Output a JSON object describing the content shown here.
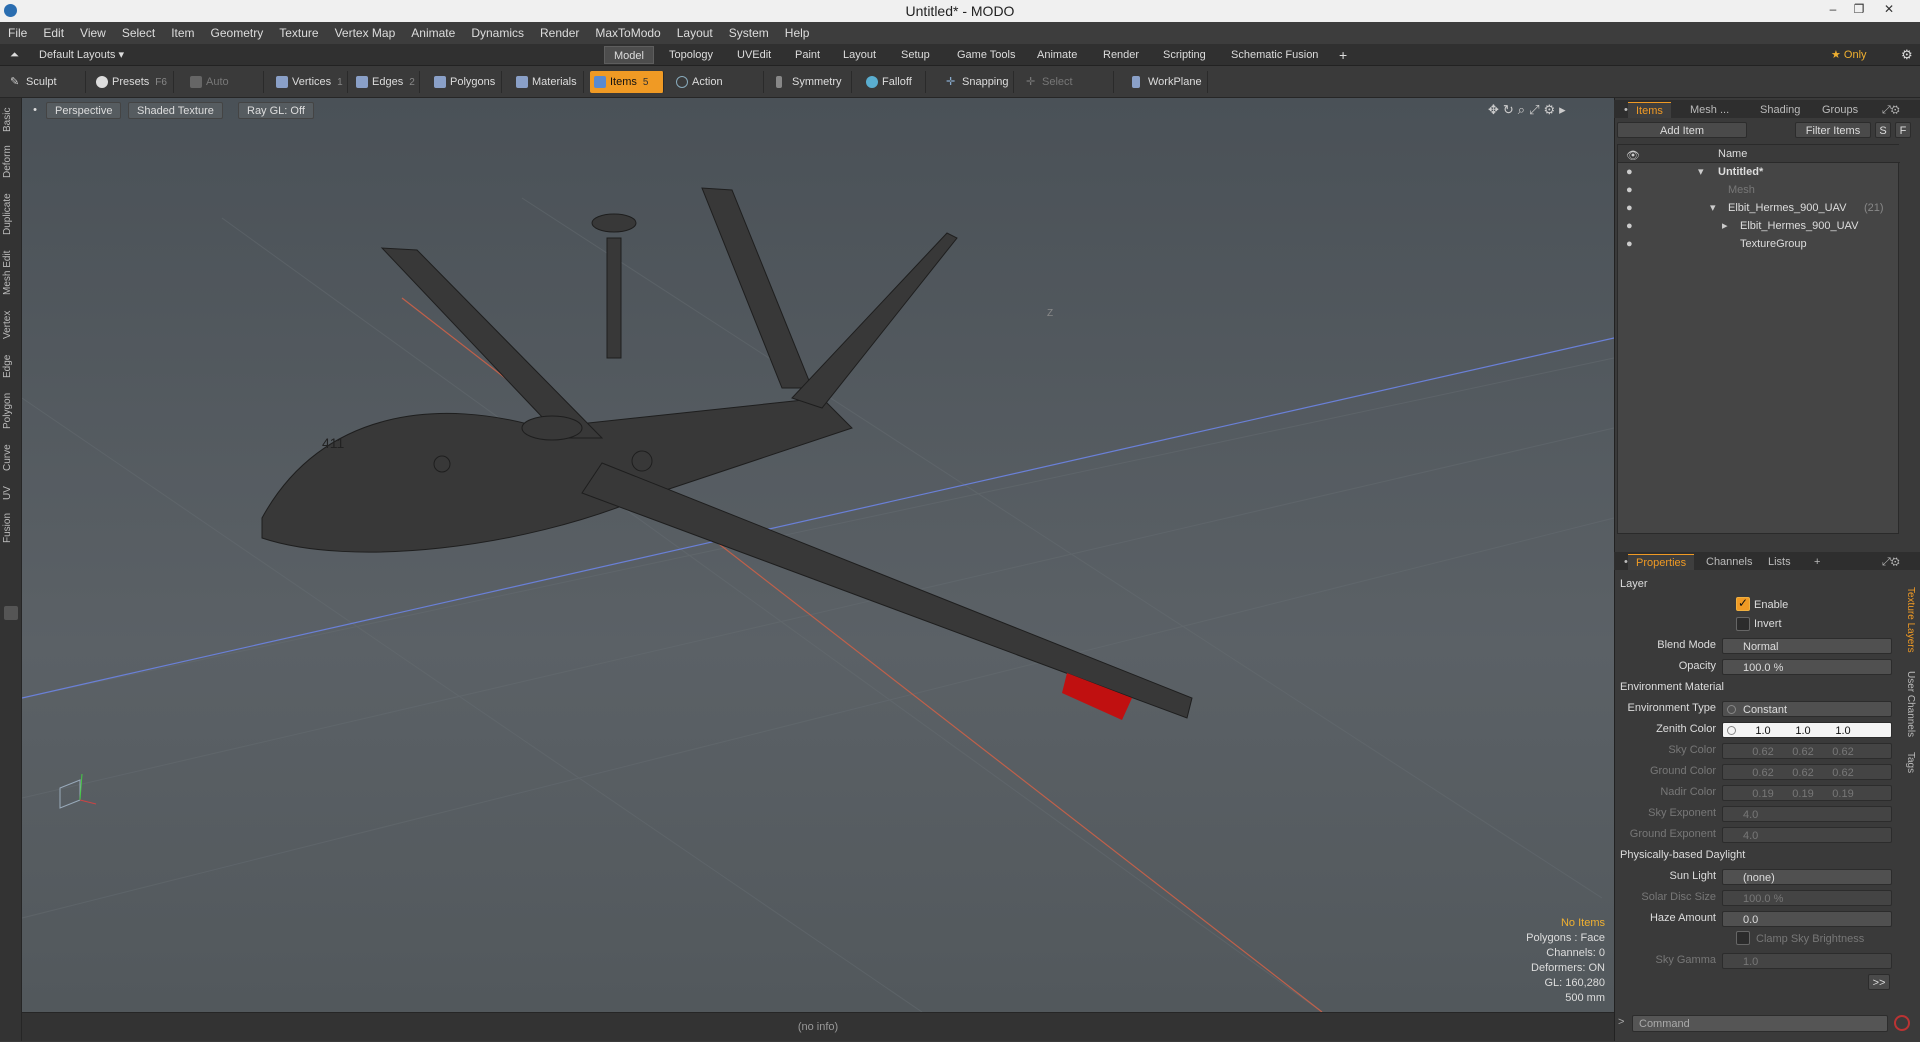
{
  "window": {
    "title": "Untitled* - MODO",
    "minimize": "–",
    "restore": "❐",
    "close": "✕"
  },
  "menu": [
    "File",
    "Edit",
    "View",
    "Select",
    "Item",
    "Geometry",
    "Texture",
    "Vertex Map",
    "Animate",
    "Dynamics",
    "Render",
    "MaxToModo",
    "Layout",
    "System",
    "Help"
  ],
  "layout_selector": "Default Layouts ▾",
  "layout_tabs": [
    "Model",
    "Topology",
    "UVEdit",
    "Paint",
    "Layout",
    "Setup",
    "Game Tools",
    "Animate",
    "Render",
    "Scripting",
    "Schematic Fusion"
  ],
  "layout_tab_active": "Model",
  "add_tab": "+",
  "only_button": "★ Only",
  "toolbar": {
    "sculpt": "Sculpt",
    "presets": "Presets",
    "presets_key": "F6",
    "auto_select": "Auto Select",
    "vertices": "Vertices",
    "vertices_count": "1",
    "edges": "Edges",
    "edges_count": "2",
    "polygons": "Polygons",
    "materials": "Materials",
    "items": "Items",
    "items_count": "5",
    "action_center": "Action Center",
    "symmetry": "Symmetry",
    "falloff": "Falloff",
    "snapping": "Snapping",
    "select_through": "Select Through",
    "workplane": "WorkPlane"
  },
  "left_tabs": [
    "Basic",
    "Deform",
    "Duplicate",
    "Mesh Edit",
    "Vertex",
    "Edge",
    "Polygon",
    "Curve",
    "UV",
    "Fusion"
  ],
  "viewport": {
    "perspective": "Perspective",
    "shading": "Shaded Texture",
    "raygl": "Ray GL: Off",
    "info": {
      "no_items": "No Items",
      "polygons": "Polygons : Face",
      "channels": "Channels: 0",
      "deformers": "Deformers: ON",
      "gl": "GL: 160,280",
      "scale": "500 mm"
    },
    "status": "(no info)",
    "axis_z_label": "Z",
    "tail_number": "411"
  },
  "items_panel": {
    "tabs": [
      "Items",
      "Mesh ...",
      "Shading",
      "Groups"
    ],
    "active_tab": "Items",
    "add_item": "Add Item",
    "filter_items": "Filter Items",
    "s": "S",
    "f": "F",
    "col_name": "Name",
    "rows": [
      {
        "name": "Untitled*",
        "count": ""
      },
      {
        "name": "Mesh",
        "count": ""
      },
      {
        "name": "Elbit_Hermes_900_UAV",
        "count": "(21)"
      },
      {
        "name": "Elbit_Hermes_900_UAV",
        "count": ""
      },
      {
        "name": "TextureGroup",
        "count": ""
      }
    ]
  },
  "properties_panel": {
    "tabs": [
      "Properties",
      "Channels",
      "Lists"
    ],
    "active_tab": "Properties",
    "add": "+",
    "layer_section": "Layer",
    "enable": "Enable",
    "invert": "Invert",
    "blend_mode_label": "Blend Mode",
    "blend_mode": "Normal",
    "opacity_label": "Opacity",
    "opacity": "100.0 %",
    "opacity_pct": 100,
    "env_section": "Environment Material",
    "env_type_label": "Environment Type",
    "env_type": "Constant",
    "zenith_label": "Zenith Color",
    "zenith": [
      "1.0",
      "1.0",
      "1.0"
    ],
    "sky_label": "Sky Color",
    "sky": [
      "0.62",
      "0.62",
      "0.62"
    ],
    "ground_label": "Ground Color",
    "ground": [
      "0.62",
      "0.62",
      "0.62"
    ],
    "nadir_label": "Nadir Color",
    "nadir": [
      "0.19",
      "0.19",
      "0.19"
    ],
    "sky_exp_label": "Sky Exponent",
    "sky_exp": "4.0",
    "ground_exp_label": "Ground Exponent",
    "ground_exp": "4.0",
    "pbd_section": "Physically-based Daylight",
    "sun_light_label": "Sun Light",
    "sun_light": "(none)",
    "solar_disc_label": "Solar Disc Size",
    "solar_disc": "100.0 %",
    "haze_label": "Haze Amount",
    "haze": "0.0",
    "clamp_sky": "Clamp Sky Brightness",
    "sky_gamma_label": "Sky Gamma",
    "sky_gamma": "1.0",
    "more": ">>"
  },
  "right_vtabs": [
    "Texture Layers",
    "User Channels",
    "Tags"
  ],
  "command_placeholder": "Command",
  "command_prompt": ">"
}
